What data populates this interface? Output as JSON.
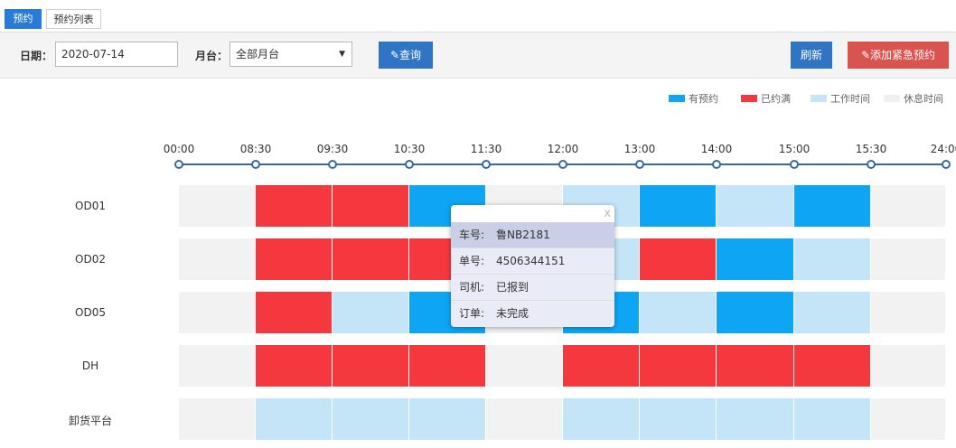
{
  "tabs": [
    {
      "label": "预约",
      "active": true
    },
    {
      "label": "预约列表",
      "active": false
    }
  ],
  "filters": {
    "date_label": "日期：",
    "date_value": "2020-07-14",
    "platform_label": "月台：",
    "platform_value": "全部月台",
    "query_label": "查询"
  },
  "actions": {
    "refresh_label": "刷新",
    "add_urgent_label": "添加紧急预约"
  },
  "legend": [
    {
      "label": "有预约",
      "color": "#0ea5f5"
    },
    {
      "label": "已约满",
      "color": "#f5383e"
    },
    {
      "label": "工作时间",
      "color": "#c4e5f7"
    },
    {
      "label": "休息时间",
      "color": "#f0f0f0"
    }
  ],
  "timeline": [
    "00:00",
    "08:30",
    "09:30",
    "10:30",
    "11:30",
    "12:00",
    "13:00",
    "14:00",
    "15:00",
    "15:30",
    "24:00"
  ],
  "status_colors": {
    "booked": "#0ea5f5",
    "full": "#f5383e",
    "work": "#c4e5f7",
    "rest": "#f2f2f2"
  },
  "rows": [
    {
      "name": "OD01",
      "slots": [
        "rest",
        "full",
        "full",
        "booked",
        "rest",
        "work",
        "booked",
        "work",
        "booked",
        "rest"
      ]
    },
    {
      "name": "OD02",
      "slots": [
        "rest",
        "full",
        "full",
        "full",
        "rest",
        "work",
        "full",
        "booked",
        "work",
        "rest"
      ]
    },
    {
      "name": "OD05",
      "slots": [
        "rest",
        "full",
        "work",
        "booked",
        "rest",
        "booked",
        "work",
        "booked",
        "work",
        "rest"
      ]
    },
    {
      "name": "DH",
      "slots": [
        "rest",
        "full",
        "full",
        "full",
        "rest",
        "full",
        "full",
        "full",
        "full",
        "rest"
      ]
    },
    {
      "name": "卸货平台",
      "slots": [
        "rest",
        "work",
        "work",
        "work",
        "rest",
        "work",
        "work",
        "work",
        "work",
        "rest"
      ]
    }
  ],
  "tooltip": {
    "close_glyph": "x",
    "rows": [
      {
        "key": "车号:",
        "value": "鲁NB2181"
      },
      {
        "key": "单号:",
        "value": "4506344151"
      },
      {
        "key": "司机:",
        "value": "已报到"
      },
      {
        "key": "订单:",
        "value": "未完成"
      }
    ]
  }
}
